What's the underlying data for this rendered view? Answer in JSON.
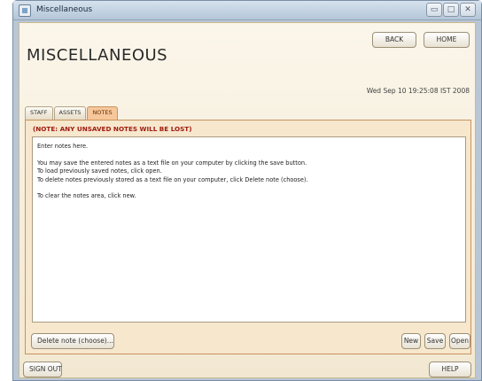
{
  "window": {
    "title": "Miscellaneous",
    "controls": [
      "minimize",
      "maximize",
      "close"
    ]
  },
  "header": {
    "title": "MISCELLANEOUS",
    "back_label": "BACK",
    "home_label": "HOME",
    "datetime": "Wed Sep 10 19:25:08 IST 2008"
  },
  "tabs": [
    {
      "label": "STAFF",
      "active": false
    },
    {
      "label": "ASSETS",
      "active": false
    },
    {
      "label": "NOTES",
      "active": true
    }
  ],
  "notes": {
    "warning": "(NOTE: ANY UNSAVED NOTES WILL BE LOST)",
    "lines": [
      "Enter notes here.",
      "",
      "You may save the entered notes as a text file on your computer by clicking the save button.",
      "To load previously saved notes, click open.",
      "To delete notes previously stored as a text file on your computer, click Delete note (choose).",
      "",
      "To clear the notes area, click new."
    ]
  },
  "actions": {
    "delete_label": "Delete note (choose)...",
    "new_label": "New",
    "save_label": "Save",
    "open_label": "Open"
  },
  "footer": {
    "signout_label": "SIGN OUT",
    "help_label": "HELP"
  },
  "colors": {
    "tab_active": "#f5c79a",
    "warning_text": "#a01b10",
    "panel_border": "#c9925e"
  }
}
